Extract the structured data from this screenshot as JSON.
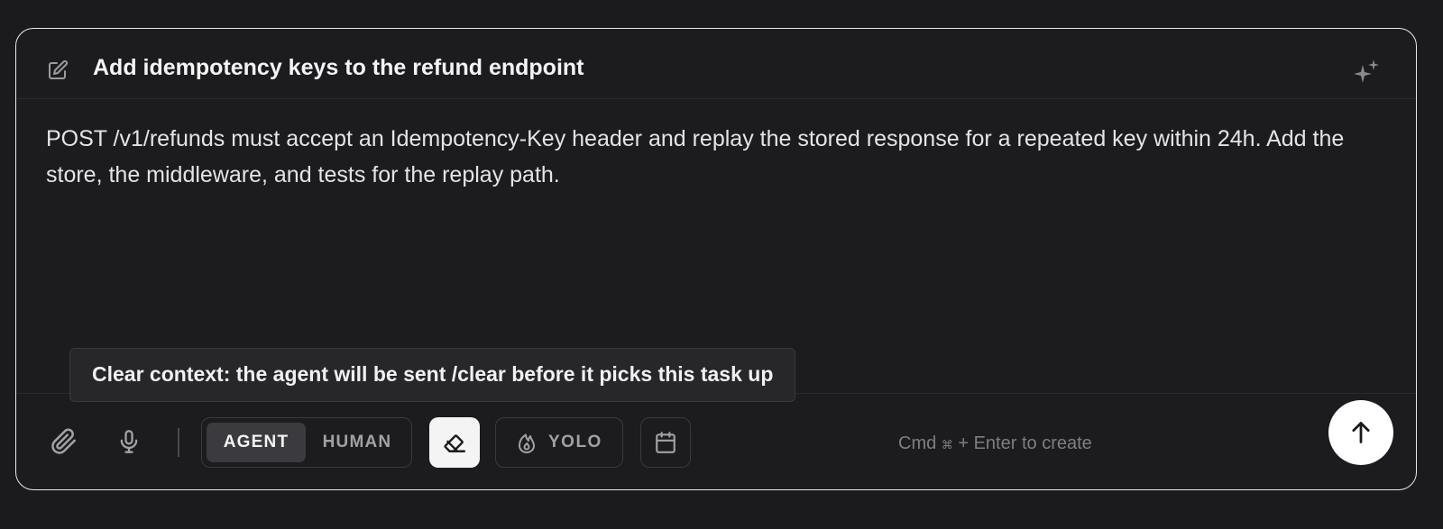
{
  "task": {
    "title": "Add idempotency keys to the refund endpoint",
    "description": "POST /v1/refunds must accept an Idempotency-Key header and replay the stored response for a repeated key within 24h. Add the store, the middleware, and tests for the replay path."
  },
  "tooltip": {
    "text": "Clear context: the agent will be sent /clear before it picks this task up"
  },
  "toolbar": {
    "assignee_options": [
      {
        "label": "AGENT",
        "selected": true
      },
      {
        "label": "HUMAN",
        "selected": false
      }
    ],
    "clear_context_active": true,
    "yolo_label": "YOLO",
    "hint_prefix": "Cmd",
    "hint_symbol": "⌘",
    "hint_suffix": "+ Enter to create"
  },
  "icons": {
    "header_left": "edit-icon",
    "header_right": "sparkles-icon",
    "attach": "paperclip-icon",
    "voice": "microphone-icon",
    "clear": "eraser-icon",
    "yolo": "flame-icon",
    "schedule": "calendar-icon",
    "send": "arrow-up-icon"
  },
  "colors": {
    "background": "#1b1b1d",
    "card_border": "#e9e9ea",
    "active_toggle": "#3a3a3f",
    "clear_button_active": "#f4f4f5",
    "send_button": "#ffffff"
  }
}
